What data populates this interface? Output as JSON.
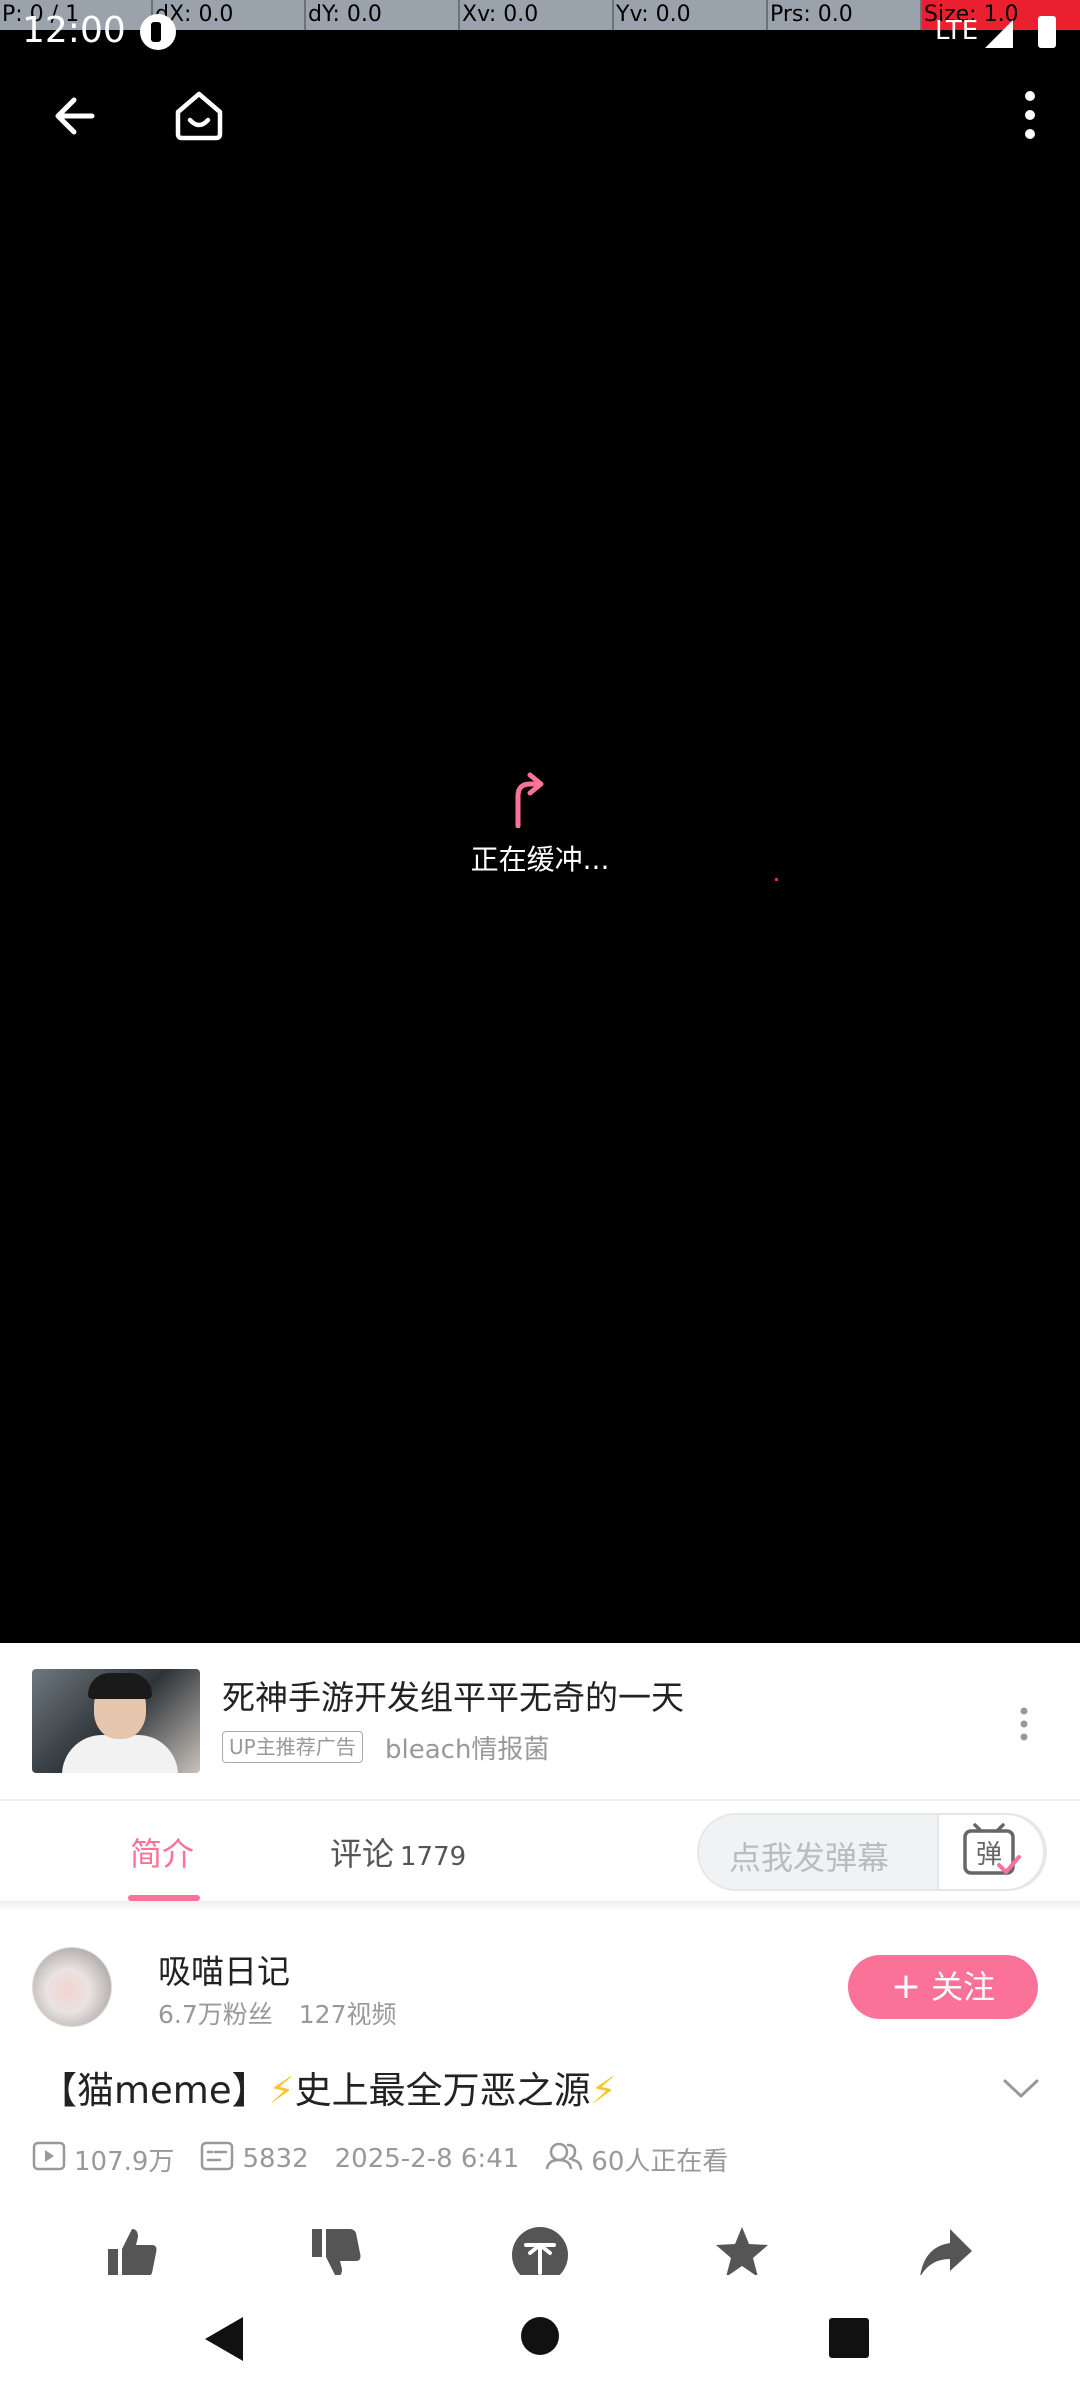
{
  "debug": {
    "p": "P: 0 / 1",
    "dx": "dX: 0.0",
    "dy": "dY: 0.0",
    "xv": "Xv: 0.0",
    "yv": "Yv: 0.0",
    "prs": "Prs: 0.0",
    "size": "Size: 1.0"
  },
  "status": {
    "time": "12:00",
    "network": "LTE"
  },
  "player": {
    "buffering_text": "正在缓冲..."
  },
  "ad": {
    "title": "死神手游开发组平平无奇的一天",
    "badge": "UP主推荐广告",
    "author": "bleach情报菌"
  },
  "tabs": {
    "intro": "简介",
    "comments": "评论",
    "comments_count": "1779",
    "danmu_placeholder": "点我发弹幕",
    "danmu_button_char": "弹"
  },
  "uploader": {
    "name": "吸喵日记",
    "fans": "6.7万粉丝",
    "videos": "127视频",
    "follow_label": "关注"
  },
  "video": {
    "title_prefix": "【猫meme】",
    "title_main": "史上最全万恶之源",
    "views": "107.9万",
    "danmaku": "5832",
    "date": "2025-2-8 6:41",
    "watching": "60人正在看"
  },
  "colors": {
    "accent": "#fb7299",
    "bolt": "#f7c531"
  },
  "icons": [
    "back-arrow-icon",
    "home-icon",
    "more-vertical-icon",
    "buffer-arrow-icon",
    "danmu-toggle-icon",
    "chevron-down-icon",
    "play-count-icon",
    "danmaku-count-icon",
    "watching-icon",
    "like-icon",
    "dislike-icon",
    "coin-icon",
    "favorite-icon",
    "share-icon"
  ]
}
